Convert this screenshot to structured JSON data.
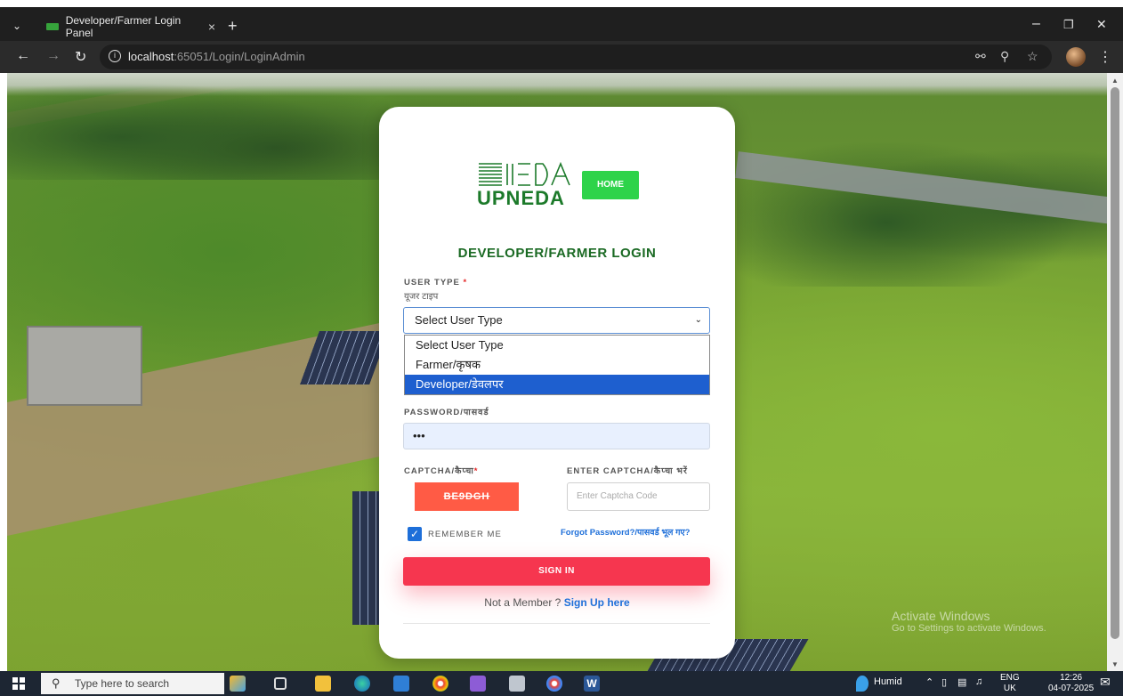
{
  "browser": {
    "tab_title": "Developer/Farmer Login Panel",
    "tab_close": "×",
    "new_tab": "+",
    "url_host": "localhost",
    "url_rest": ":65051/Login/LoginAdmin",
    "minimize": "–",
    "restore": "❐",
    "close": "✕"
  },
  "page": {
    "home_label": "HOME",
    "logo_text": "UPNEDA",
    "title": "DEVELOPER/FARMER LOGIN",
    "user_type_label": "USER TYPE",
    "required_mark": "*",
    "user_type_sublabel": "यूजर टाइप",
    "user_type_value": "Select User Type",
    "user_type_options": [
      "Select User Type",
      "Farmer/कृषक",
      "Developer/डेवलपर"
    ],
    "user_type_highlighted": "Developer/डेवलपर",
    "password_label": "PASSWORD/पासवर्ड",
    "password_value": "•••",
    "captcha_label": "CAPTCHA/कैप्चा",
    "captcha_code": "BE9DGH",
    "enter_captcha_label": "ENTER CAPTCHA/कैप्चा भरें",
    "captcha_placeholder": "Enter Captcha Code",
    "remember_label": "REMEMBER ME",
    "remember_checked": true,
    "forgot_label": "Forgot Password?/पासवर्ड भूल गए?",
    "signin_label": "SIGN IN",
    "member_text": "Not a Member ?",
    "signup_label": "Sign Up here",
    "watermark_title": "Activate Windows",
    "watermark_sub": "Go to Settings to activate Windows."
  },
  "taskbar": {
    "search_placeholder": "Type here to search",
    "weather": "Humid",
    "lang_top": "ENG",
    "lang_bottom": "UK",
    "time": "12:26",
    "date": "04-07-2025"
  },
  "colors": {
    "accent_green": "#1b6a24",
    "home_green": "#2ed34a",
    "signin_red": "#f6364f",
    "captcha_bg": "#ff5b45",
    "link_blue": "#1e6fd9"
  }
}
